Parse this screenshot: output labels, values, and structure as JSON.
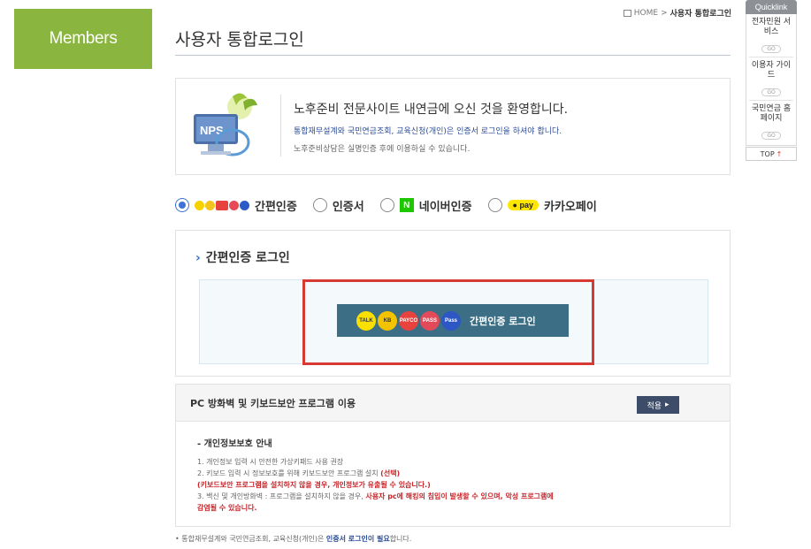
{
  "sidebar": {
    "members_label": "Members"
  },
  "breadcrumb": {
    "home": "HOME",
    "sep": ">",
    "current": "사용자 통합로그인"
  },
  "page": {
    "title": "사용자 통합로그인"
  },
  "welcome": {
    "logo_text": "NPS",
    "heading": "노후준비 전문사이트 내연금에 오신 것을 환영합니다.",
    "line1": "통합재무설계와 국민연금조회, 교육신청(개인)은 인증서 로그인을 하셔야 합니다.",
    "line2": "노후준비상담은 실명인증 후에 이용하실 수 있습니다."
  },
  "login_methods": [
    {
      "label": "간편인증",
      "selected": true
    },
    {
      "label": "인증서",
      "selected": false
    },
    {
      "label": "네이버인증",
      "icon_text": "N",
      "selected": false
    },
    {
      "label": "카카오페이",
      "icon_text": "pay",
      "selected": false
    }
  ],
  "simple_auth": {
    "title": "간편인증 로그인",
    "button_label": "간편인증 로그인",
    "provider_icons": [
      "TALK",
      "KB",
      "PAYCO",
      "PASS",
      "Pass"
    ]
  },
  "pc_security": {
    "title": "PC 방화벽 및 키보드보안 프로그램 이용",
    "apply_label": "적용",
    "privacy_heading": "- 개인정보보호 안내",
    "items": [
      "1. 개인정보 입력 시 안전한 가상키패드 사용 권장",
      "2. 키보드 입력 시 정보보호를 위해 키보드보안 프로그램 설치",
      "(선택)",
      "(키보드보안 프로그램을 설치하지 않을 경우, 개인정보가 유출될 수 있습니다.)",
      "3. 백신 및 개인방화벽 : 프로그램을 설치하지 않을 경우,",
      "사용자 pc에 해킹의 침입이 발생할 수 있으며, 악성 프로그램에",
      "감염될 수 있습니다."
    ]
  },
  "footer": {
    "note_prefix": "• 통합재무설계와 국민연금조회, 교육신청(개인)은 ",
    "note_highlight": "인증서 로그인이 필요",
    "note_suffix": "합니다."
  },
  "quicklink": {
    "title": "Quicklink",
    "items": [
      {
        "label": "전자민원 서비스",
        "go": "GO"
      },
      {
        "label": "이용자 가이드",
        "go": "GO"
      },
      {
        "label": "국민연금 홈페이지",
        "go": "GO"
      }
    ],
    "top_label": "TOP"
  },
  "colors": {
    "members_green": "#8ab53f",
    "auth_button": "#3c6f86",
    "highlight_red": "#d63a32",
    "radio_blue": "#3f73d6"
  }
}
